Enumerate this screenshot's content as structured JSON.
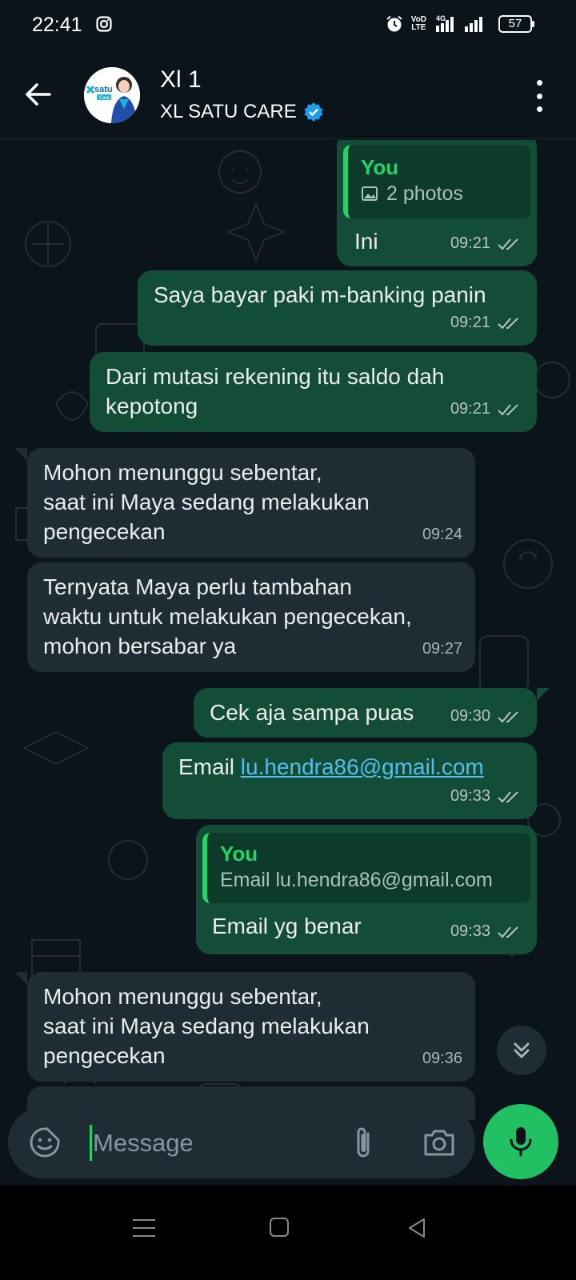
{
  "status_bar": {
    "time": "22:41",
    "network_label_top": "VoD",
    "network_label_bottom": "LTE",
    "network_type": "4G",
    "battery": "57",
    "icons": [
      "instagram-icon",
      "alarm-icon",
      "signal-icon",
      "battery-icon"
    ]
  },
  "header": {
    "name": "Xl 1",
    "subtitle": "XL SATU CARE",
    "avatar_logo_text": "satu",
    "avatar_logo_sub": "Care",
    "icons": [
      "back-arrow-icon",
      "verified-badge-icon",
      "more-vert-icon"
    ]
  },
  "messages": [
    {
      "direction": "out",
      "quote_author": "You",
      "quote_text": "2 photos",
      "text": "Ini",
      "time": "09:21",
      "status": "read"
    },
    {
      "direction": "out",
      "text": "Saya bayar paki m-banking panin",
      "time": "09:21",
      "status": "read"
    },
    {
      "direction": "out",
      "text": "Dari mutasi rekening itu saldo dah\nkepotong",
      "time": "09:21",
      "status": "read"
    },
    {
      "direction": "in",
      "text": "Mohon menunggu sebentar,\nsaat ini Maya sedang melakukan\npengecekan",
      "time": "09:24"
    },
    {
      "direction": "in",
      "text": "Ternyata Maya perlu tambahan\nwaktu untuk melakukan pengecekan,\nmohon bersabar ya",
      "time": "09:27"
    },
    {
      "direction": "out",
      "text": "Cek aja sampa puas",
      "time": "09:30",
      "status": "read"
    },
    {
      "direction": "out",
      "text_prefix": "Email ",
      "link": "lu.hendra86@gmail.com",
      "time": "09:33",
      "status": "read"
    },
    {
      "direction": "out",
      "quote_author": "You",
      "quote_text": "Email lu.hendra86@gmail.com",
      "text": "Email yg benar",
      "time": "09:33",
      "status": "read"
    },
    {
      "direction": "in",
      "text": "Mohon menunggu sebentar,\nsaat ini Maya sedang melakukan\npengecekan",
      "time": "09:36"
    }
  ],
  "composer": {
    "placeholder": "Message",
    "icons": [
      "sticker-icon",
      "attach-icon",
      "camera-icon",
      "mic-icon",
      "scroll-down-icon"
    ]
  },
  "colors": {
    "background": "#0b141a",
    "outgoing_bubble": "#144d37",
    "incoming_bubble": "#202c33",
    "accent": "#25d366",
    "link": "#53bdeb"
  }
}
